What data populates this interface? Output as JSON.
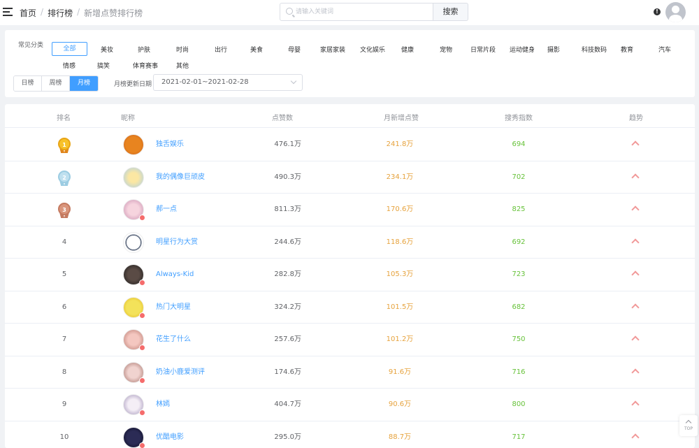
{
  "header": {
    "breadcrumb": [
      "首页",
      "排行榜",
      "新增点赞排行榜"
    ],
    "search_placeholder": "请输入关键词",
    "search_button": "搜索"
  },
  "filters": {
    "category_label": "常见分类",
    "categories": [
      "全部",
      "美妆",
      "护肤",
      "时尚",
      "出行",
      "美食",
      "母婴",
      "家居家装",
      "文化娱乐",
      "健康",
      "宠物",
      "日常片段",
      "运动健身",
      "摄影",
      "科技数码",
      "教育",
      "汽车",
      "情感",
      "搞笑",
      "体育赛事",
      "其他"
    ],
    "active_category": "全部",
    "ranges": [
      "日榜",
      "周榜",
      "月榜"
    ],
    "active_range": "月榜",
    "date_label": "月榜更新日期",
    "date_value": "2021-02-01~2021-02-28"
  },
  "table": {
    "headers": [
      "排名",
      "昵称",
      "点赞数",
      "月新增点赞",
      "搜秀指数",
      "趋势"
    ],
    "rows": [
      {
        "rank": "1",
        "name": "独舌娱乐",
        "likes": "476.1万",
        "monthly": "241.8万",
        "index": "694"
      },
      {
        "rank": "2",
        "name": "我的偶像巨顽皮",
        "likes": "490.3万",
        "monthly": "234.1万",
        "index": "702"
      },
      {
        "rank": "3",
        "name": "郝一点",
        "likes": "811.3万",
        "monthly": "170.6万",
        "index": "825"
      },
      {
        "rank": "4",
        "name": "明星行为大赏",
        "likes": "244.6万",
        "monthly": "118.6万",
        "index": "692"
      },
      {
        "rank": "5",
        "name": "Always-Kid",
        "likes": "282.8万",
        "monthly": "105.3万",
        "index": "723"
      },
      {
        "rank": "6",
        "name": "热门大明星",
        "likes": "324.2万",
        "monthly": "101.5万",
        "index": "682"
      },
      {
        "rank": "7",
        "name": "花生了什么",
        "likes": "257.6万",
        "monthly": "101.2万",
        "index": "750"
      },
      {
        "rank": "8",
        "name": "奶油小鹿爱测评",
        "likes": "174.6万",
        "monthly": "91.6万",
        "index": "716"
      },
      {
        "rank": "9",
        "name": "林嫣",
        "likes": "404.7万",
        "monthly": "90.6万",
        "index": "800"
      },
      {
        "rank": "10",
        "name": "优酷电影",
        "likes": "295.0万",
        "monthly": "88.7万",
        "index": "717"
      }
    ]
  },
  "top_button": "TOP",
  "colors": {
    "primary": "#409eff",
    "monthly": "#e6a23c",
    "index": "#67c23a",
    "trend": "#f19999"
  }
}
